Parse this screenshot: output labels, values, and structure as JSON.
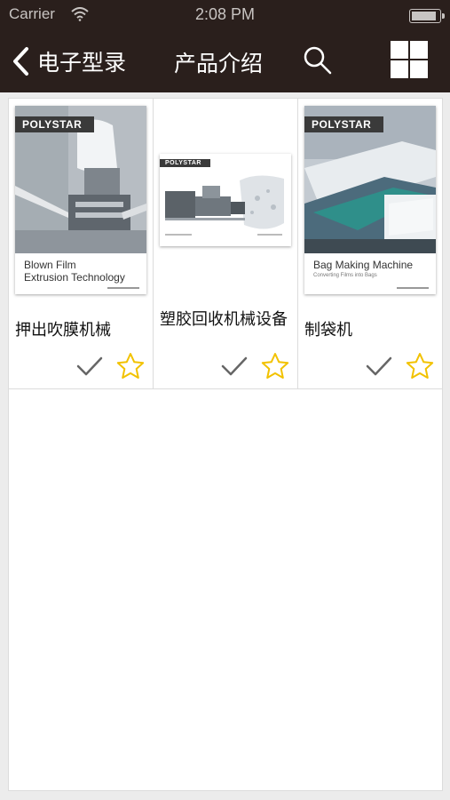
{
  "status_bar": {
    "carrier": "Carrier",
    "time": "2:08 PM",
    "battery_level": 0.9
  },
  "nav": {
    "back_label": "电子型录",
    "title": "产品介绍",
    "search_icon": "search-icon",
    "grid_icon": "grid-view-icon"
  },
  "products": [
    {
      "title": "押出吹膜机械",
      "cover_brand": "POLYSTAR",
      "cover_title_line1": "Blown Film",
      "cover_title_line2": "Extrusion Technology",
      "cover_subtitle": ""
    },
    {
      "title": "塑胶回收机械设备",
      "cover_brand": "POLYSTAR",
      "cover_title_line1": "",
      "cover_title_line2": "",
      "cover_subtitle": ""
    },
    {
      "title": "制袋机",
      "cover_brand": "POLYSTAR",
      "cover_title_line1": "Bag Making Machine",
      "cover_title_line2": "",
      "cover_subtitle": "Converting Films into Bags"
    }
  ],
  "colors": {
    "navbar": "#2a1f1c",
    "star": "#f2c200",
    "check": "#666666"
  }
}
